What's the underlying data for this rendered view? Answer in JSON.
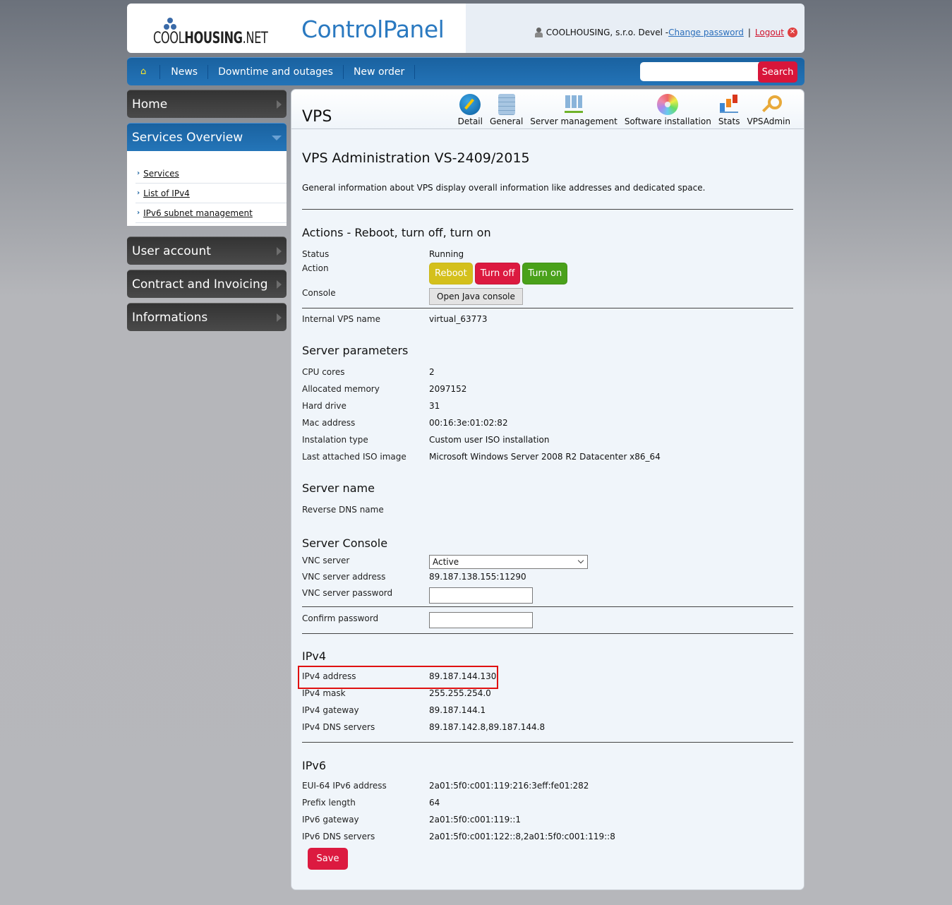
{
  "header": {
    "logo_light": "COOL",
    "logo_bold": "HOUSING",
    "logo_suffix": ".NET",
    "app_title": "ControlPanel",
    "user_text": "COOLHOUSING, s.r.o. Devel -",
    "change_password": "Change password",
    "separator": "|",
    "logout": "Logout",
    "logout_icon": "✕"
  },
  "navbar": {
    "home_icon": "⌂",
    "items": [
      "News",
      "Downtime and outages",
      "New order"
    ],
    "search_placeholder": "",
    "search_value": "",
    "search_button": "Search"
  },
  "sidebar": {
    "items": [
      {
        "label": "Home"
      },
      {
        "label": "Services Overview",
        "expanded": true
      },
      {
        "label": "User account"
      },
      {
        "label": "Contract and Invoicing"
      },
      {
        "label": "Informations"
      }
    ],
    "submenu": [
      "Services",
      "List of IPv4",
      "IPv6 subnet management"
    ],
    "submenu_chevron": "›"
  },
  "main": {
    "title": "VPS",
    "toolbar": [
      {
        "label": "Detail",
        "icon": "pencil-icon"
      },
      {
        "label": "General",
        "icon": "database-icon"
      },
      {
        "label": "Server management",
        "icon": "network-icon"
      },
      {
        "label": "Software installation",
        "icon": "disc-icon"
      },
      {
        "label": "Stats",
        "icon": "bar-chart-icon"
      },
      {
        "label": "VPSAdmin",
        "icon": "key-icon"
      }
    ],
    "heading": "VPS Administration VS-2409/2015",
    "intro": "General information about VPS display overall information like addresses and dedicated space.",
    "actions": {
      "title": "Actions - Reboot, turn off, turn on",
      "status_label": "Status",
      "status_value": "Running",
      "action_label": "Action",
      "reboot": "Reboot",
      "turn_off": "Turn off",
      "turn_on": "Turn on",
      "console_label": "Console",
      "console_button": "Open Java console",
      "internal_name_label": "Internal VPS name",
      "internal_name_value": "virtual_63773"
    },
    "server_params": {
      "title": "Server parameters",
      "rows": [
        {
          "k": "CPU cores",
          "v": "2"
        },
        {
          "k": "Allocated memory",
          "v": "2097152"
        },
        {
          "k": "Hard drive",
          "v": "31"
        },
        {
          "k": "Mac address",
          "v": "00:16:3e:01:02:82"
        },
        {
          "k": "Instalation type",
          "v": "Custom user ISO installation"
        },
        {
          "k": "Last attached ISO image",
          "v": "Microsoft Windows Server 2008 R2 Datacenter x86_64"
        }
      ]
    },
    "server_name": {
      "title": "Server name",
      "rdns_label": "Reverse DNS name",
      "rdns_value": ""
    },
    "console": {
      "title": "Server Console",
      "vnc_label": "VNC server",
      "vnc_value": "Active",
      "vnc_addr_label": "VNC server address",
      "vnc_addr_value": "89.187.138.155:11290",
      "vnc_pw_label": "VNC server password",
      "vnc_pw_value": "",
      "confirm_label": "Confirm password",
      "confirm_value": ""
    },
    "ipv4": {
      "title": "IPv4",
      "rows": [
        {
          "k": "IPv4 address",
          "v": "89.187.144.130"
        },
        {
          "k": "IPv4 mask",
          "v": "255.255.254.0"
        },
        {
          "k": "IPv4 gateway",
          "v": "89.187.144.1"
        },
        {
          "k": "IPv4 DNS servers",
          "v": "89.187.142.8,89.187.144.8"
        }
      ]
    },
    "ipv6": {
      "title": "IPv6",
      "rows": [
        {
          "k": "EUI-64 IPv6 address",
          "v": "2a01:5f0:c001:119:216:3eff:fe01:282"
        },
        {
          "k": "Prefix length",
          "v": "64"
        },
        {
          "k": "IPv6 gateway",
          "v": "2a01:5f0:c001:119::1"
        },
        {
          "k": "IPv6 DNS servers",
          "v": "2a01:5f0:c001:122::8,2a01:5f0:c001:119::8"
        }
      ]
    },
    "save": "Save"
  },
  "colors": {
    "brand_blue": "#2373b7",
    "accent_red": "#dc1a40",
    "reboot_yellow": "#d4c01c",
    "turn_on_green": "#4aa11a",
    "highlight_red": "#e01010"
  }
}
